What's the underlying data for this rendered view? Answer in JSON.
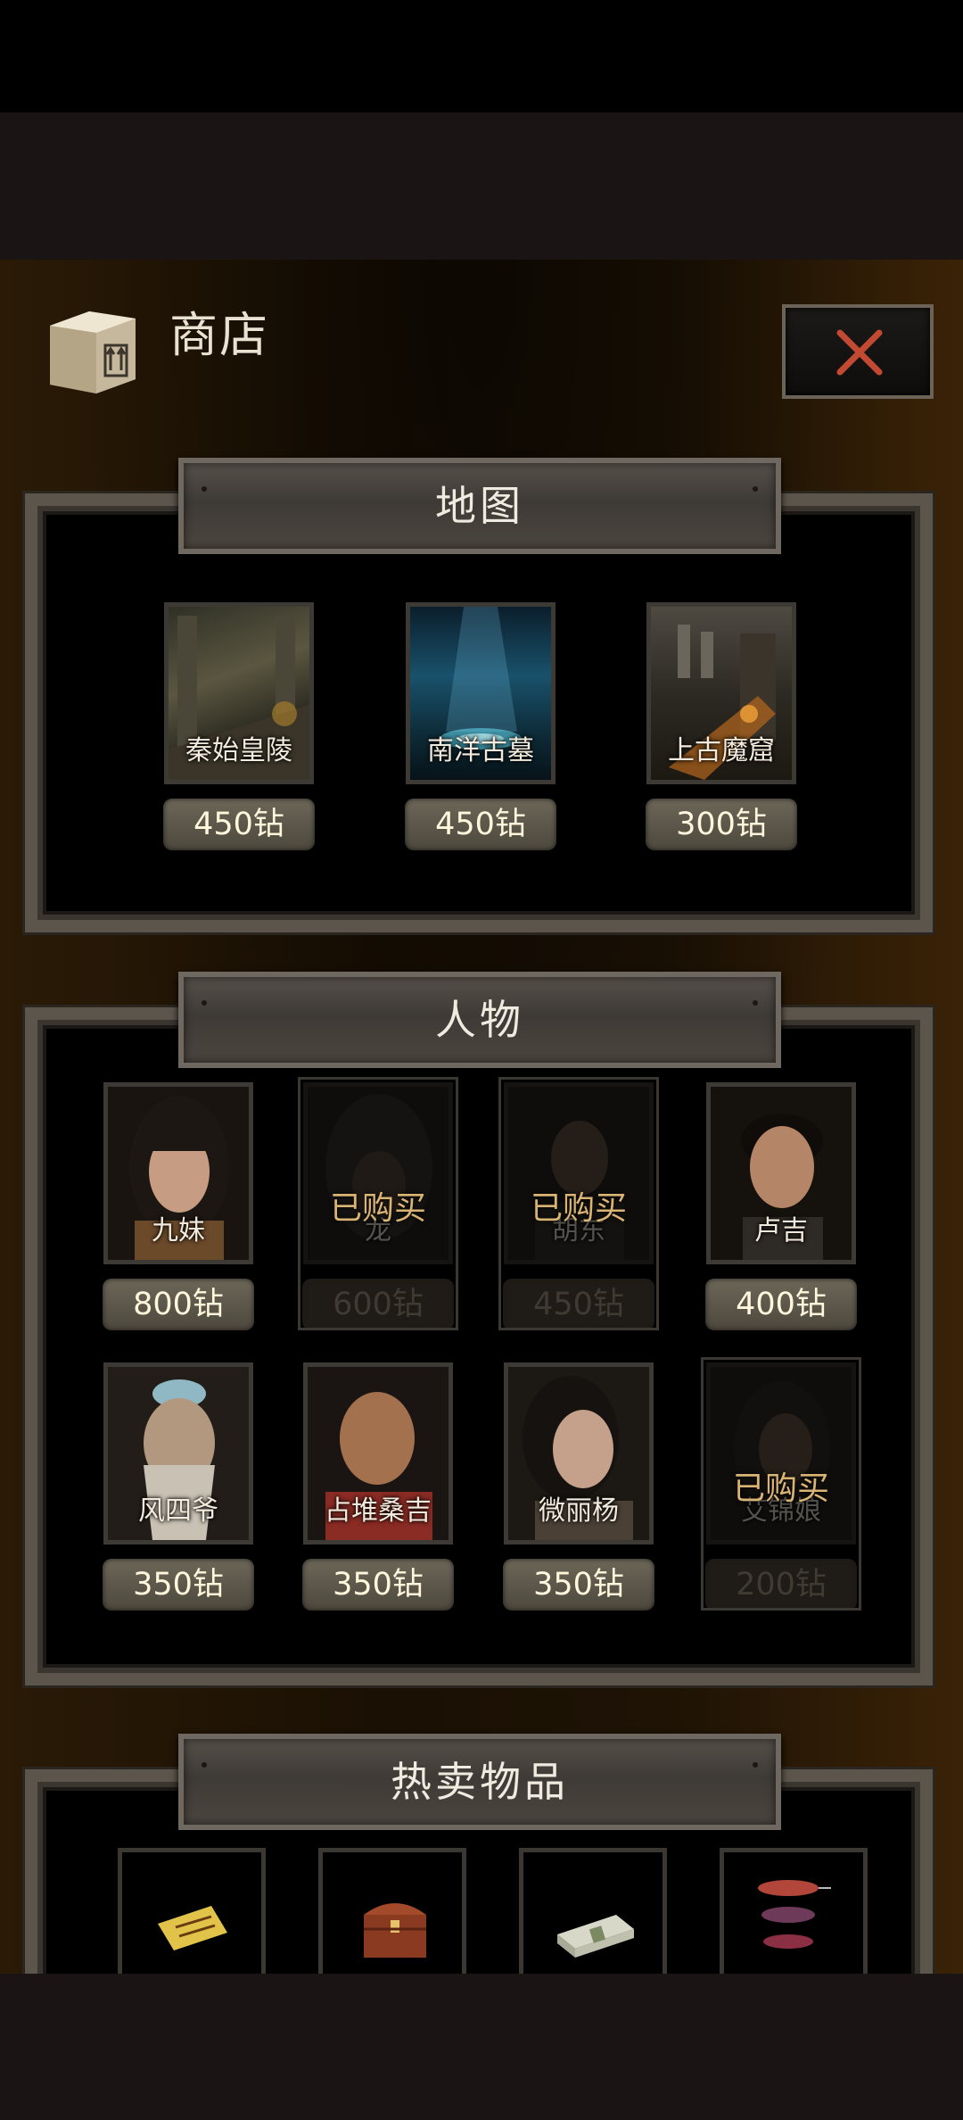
{
  "header": {
    "title": "商店",
    "box_icon": "box-icon",
    "close_icon": "close-x-icon"
  },
  "sections": {
    "maps": {
      "title": "地图"
    },
    "characters": {
      "title": "人物"
    },
    "hot": {
      "title": "热卖物品"
    }
  },
  "maps": [
    {
      "name": "秦始皇陵",
      "price": "450钻"
    },
    {
      "name": "南洋古墓",
      "price": "450钻"
    },
    {
      "name": "上古魔窟",
      "price": "300钻"
    }
  ],
  "characters": [
    {
      "name": "九妹",
      "price": "800钻",
      "bought": ""
    },
    {
      "name": "龙",
      "price": "600钻",
      "bought": "已购买"
    },
    {
      "name": "胡东",
      "price": "450钻",
      "bought": "已购买"
    },
    {
      "name": "卢吉",
      "price": "400钻",
      "bought": ""
    },
    {
      "name": "风四爷",
      "price": "350钻",
      "bought": ""
    },
    {
      "name": "占堆桑吉",
      "price": "350钻",
      "bought": ""
    },
    {
      "name": "微丽杨",
      "price": "350钻",
      "bought": ""
    },
    {
      "name": "艾锦娘",
      "price": "200钻",
      "bought": "已购买"
    }
  ],
  "hot_items": [
    {
      "icon": "talisman-icon"
    },
    {
      "icon": "treasure-chest-icon"
    },
    {
      "icon": "cash-stack-icon"
    },
    {
      "icon": "fish-lures-icon"
    }
  ],
  "colors": {
    "accent_close": "#c24a32",
    "price_text": "#fff6dc",
    "bought_text": "#d9b473"
  }
}
